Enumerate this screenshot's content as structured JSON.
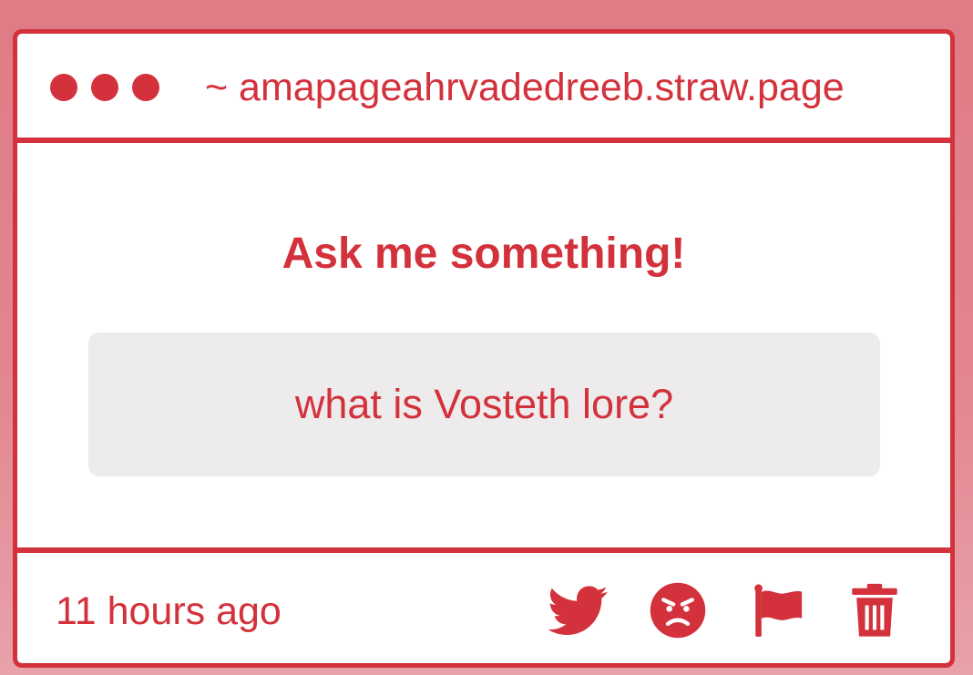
{
  "titlebar": {
    "url": "~ amapageahrvadedreeb.straw.page",
    "window_controls": [
      "dot-icon",
      "dot-icon",
      "dot-icon"
    ]
  },
  "main": {
    "heading": "Ask me something!",
    "question": "what is Vosteth lore?"
  },
  "footer": {
    "timestamp": "11 hours ago",
    "actions": [
      "twitter-icon",
      "angry-face-icon",
      "flag-icon",
      "trash-icon"
    ]
  },
  "colors": {
    "accent": "#d3313b",
    "background_top": "#df7c86",
    "background_bottom": "#e9a2aa",
    "question_box": "#edebec",
    "window": "#ffffff"
  }
}
